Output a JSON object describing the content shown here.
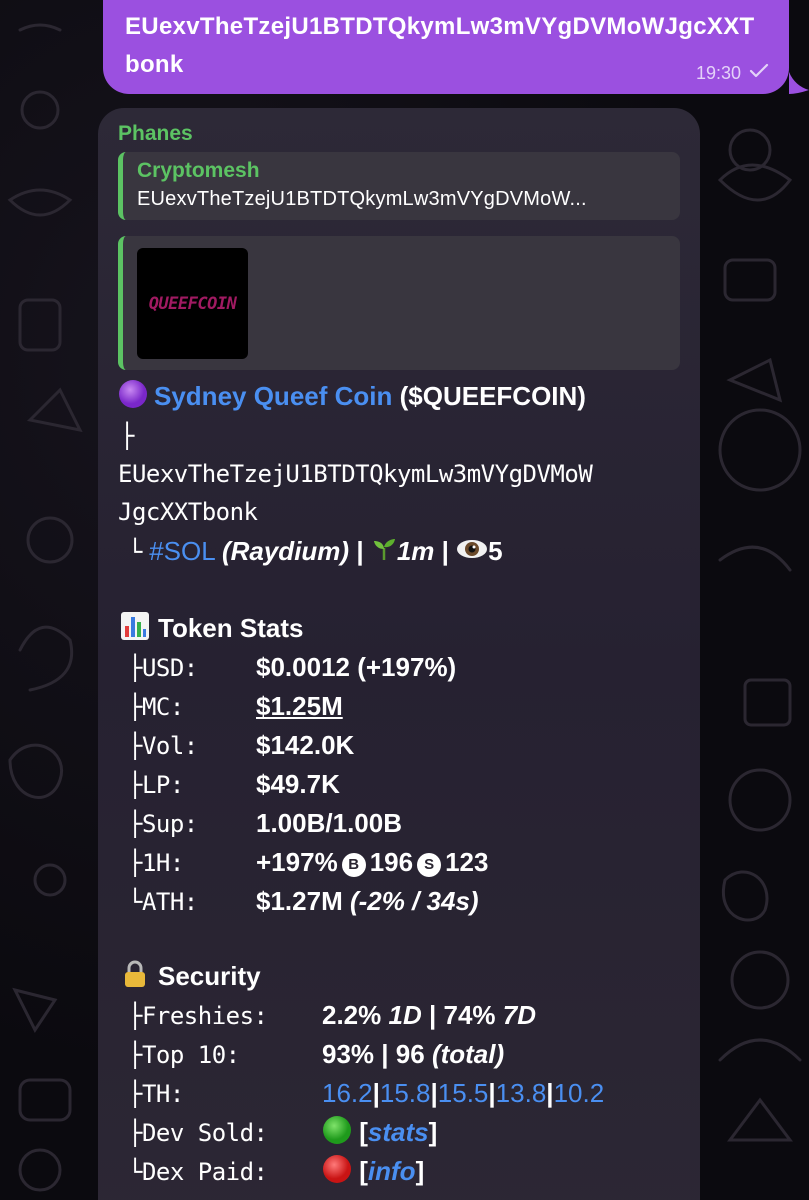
{
  "outgoing": {
    "text": "EUexvTheTzejU1BTDTQkymLw3mVYgDVMoWJgcXXTbonk",
    "time": "19:30"
  },
  "incoming": {
    "sender": "Phanes",
    "reply": {
      "name": "Cryptomesh",
      "text": "EUexvTheTzejU1BTDTQkymLw3mVYgDVMoW..."
    },
    "preview_logo_text": "QUEEFCOIN",
    "token": {
      "emoji": "purple-circle",
      "name": "Sydney Queef Coin",
      "ticker": "($QUEEFCOIN)",
      "tree_top": "├",
      "address_line1": "EUexvTheTzejU1BTDTQkymLw3mVYgDVMoW",
      "address_line2": "JgcXXTbonk",
      "chain_prefix": "└",
      "chain": "#SOL",
      "dex": "(Raydium)",
      "sep1": "|",
      "age": "1m",
      "sep2": "|",
      "views": "5"
    },
    "token_stats": {
      "title": "Token Stats",
      "rows": [
        {
          "prefix": "├",
          "label": "USD:",
          "value": "$0.0012",
          "extra": "(+197%)"
        },
        {
          "prefix": "├",
          "label": "MC:",
          "value": "$1.25M"
        },
        {
          "prefix": "├",
          "label": "Vol:",
          "value": "$142.0K"
        },
        {
          "prefix": "├",
          "label": "LP:",
          "value": "$49.7K"
        },
        {
          "prefix": "├",
          "label": "Sup:",
          "value": "1.00B/1.00B"
        },
        {
          "prefix": "├",
          "label": "1H:",
          "value": "+197%",
          "b_badge": "B",
          "buys": "196",
          "s_badge": "S",
          "sells": "123"
        },
        {
          "prefix": "└",
          "label": "ATH:",
          "value": "$1.27M",
          "extra": "(-2% / 34s)"
        }
      ]
    },
    "security": {
      "title": "Security",
      "freshies": {
        "prefix": "├",
        "label": "Freshies:",
        "v1": "2.2%",
        "v1u": "1D",
        "sep": "|",
        "v2": "74%",
        "v2u": "7D"
      },
      "top10": {
        "prefix": "├",
        "label": "Top 10:",
        "v": "93%",
        "sep": "|",
        "count": "96",
        "unit": "(total)"
      },
      "th": {
        "prefix": "├",
        "label": "TH:",
        "values": [
          "16.2",
          "15.8",
          "15.5",
          "13.8",
          "10.2"
        ],
        "sep": "|"
      },
      "dev_sold": {
        "prefix": "├",
        "label": "Dev Sold:",
        "status": "green",
        "link": "stats"
      },
      "dex_paid": {
        "prefix": "└",
        "label": "Dex Paid:",
        "status": "red",
        "link": "info"
      }
    }
  },
  "colors": {
    "outgoing_bubble": "#9b50e0",
    "sender": "#5cc363",
    "link": "#4a8ff1",
    "incoming_bubble": "#2a2533"
  }
}
